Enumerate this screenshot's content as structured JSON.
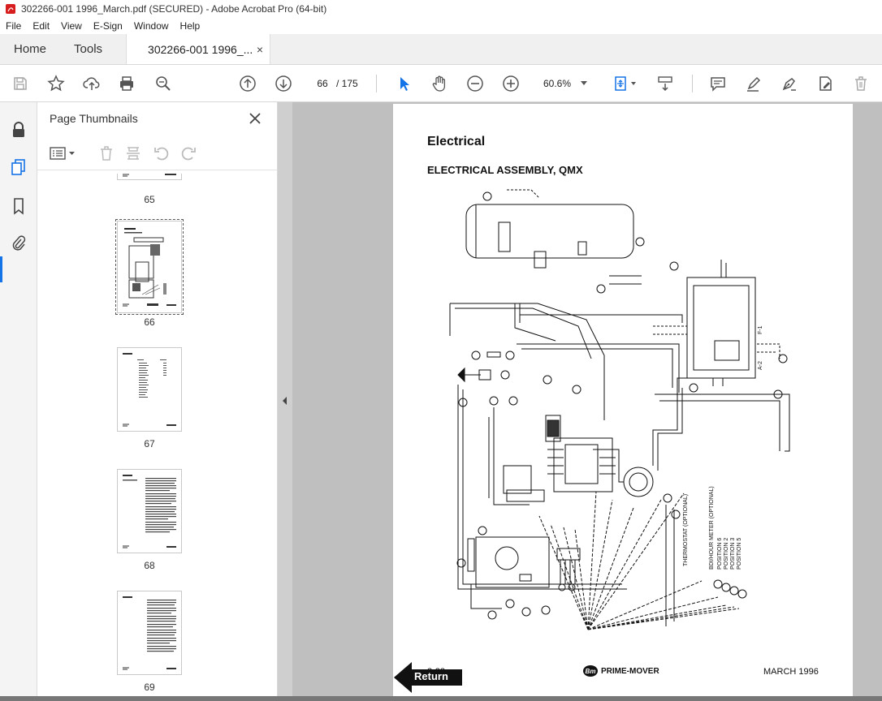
{
  "window": {
    "title": "302266-001 1996_March.pdf (SECURED) - Adobe Acrobat Pro (64-bit)"
  },
  "menu": [
    "File",
    "Edit",
    "View",
    "E-Sign",
    "Window",
    "Help"
  ],
  "tabs": {
    "home": "Home",
    "tools": "Tools",
    "document": "302266-001 1996_...",
    "close": "×"
  },
  "toolbar": {
    "current_page": "66",
    "total_pages": "/  175",
    "zoom": "60.6%"
  },
  "panel": {
    "title": "Page Thumbnails",
    "thumbnails": [
      {
        "label": "65",
        "selected": false
      },
      {
        "label": "66",
        "selected": true
      },
      {
        "label": "67",
        "selected": false
      },
      {
        "label": "68",
        "selected": false
      },
      {
        "label": "69",
        "selected": false
      }
    ]
  },
  "page": {
    "heading": "Electrical",
    "subheading": "ELECTRICAL ASSEMBLY, QMX",
    "page_number": "2-22",
    "brand": "PRIME-MOVER",
    "brand_logo": "Bm",
    "date": "MARCH 1996",
    "return_label": "Return",
    "diagram_labels": {
      "thermostat": "THERMOSTAT (OPTIONAL)",
      "hour_meter": "BDI/HOUR METER (OPTIONAL)",
      "positions": [
        "POSITION 6",
        "POSITION 2",
        "POSITION 3",
        "POSITION 5"
      ],
      "f1": "F-1",
      "a2": "A-2"
    }
  }
}
